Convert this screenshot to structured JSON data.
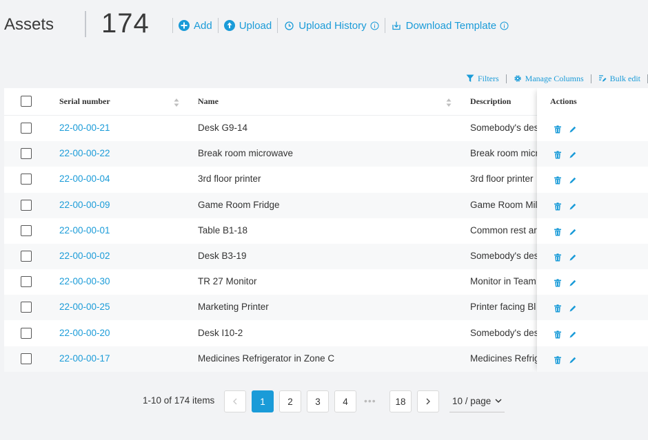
{
  "header": {
    "title": "Assets",
    "count": "174",
    "links": [
      {
        "label": "Add",
        "icon": "plus-circle-icon"
      },
      {
        "label": "Upload",
        "icon": "upload-circle-icon"
      },
      {
        "label": "Upload History",
        "icon": "history-icon",
        "info": true
      },
      {
        "label": "Download Template",
        "icon": "download-icon",
        "info": true
      }
    ]
  },
  "toolbar": {
    "filters": "Filters",
    "manage_columns": "Manage Columns",
    "bulk_edit": "Bulk edit"
  },
  "table": {
    "columns": {
      "serial": "Serial number",
      "name": "Name",
      "description": "Description",
      "actions": "Actions"
    },
    "rows": [
      {
        "serial": "22-00-00-21",
        "name": "Desk G9-14",
        "description": "Somebody's desk"
      },
      {
        "serial": "22-00-00-22",
        "name": "Break room microwave",
        "description": "Break room microwave"
      },
      {
        "serial": "22-00-00-04",
        "name": "3rd floor printer",
        "description": "3rd floor printer"
      },
      {
        "serial": "22-00-00-09",
        "name": "Game Room Fridge",
        "description": "Game Room Mill"
      },
      {
        "serial": "22-00-00-01",
        "name": "Table B1-18",
        "description": "Common rest area"
      },
      {
        "serial": "22-00-00-02",
        "name": "Desk B3-19",
        "description": "Somebody's desk"
      },
      {
        "serial": "22-00-00-30",
        "name": "TR 27 Monitor",
        "description": "Monitor in Team"
      },
      {
        "serial": "22-00-00-25",
        "name": "Marketing Printer",
        "description": "Printer facing Bl"
      },
      {
        "serial": "22-00-00-20",
        "name": "Desk I10-2",
        "description": "Somebody's desk"
      },
      {
        "serial": "22-00-00-17",
        "name": "Medicines Refrigerator in Zone C",
        "description": "Medicines Refrigerator"
      }
    ]
  },
  "pagination": {
    "total_text": "1-10 of 174 items",
    "prev": "<",
    "next": ">",
    "pages": [
      "1",
      "2",
      "3",
      "4"
    ],
    "ellipsis": "•••",
    "last_page": "18",
    "current": "1",
    "page_size": "10 / page"
  },
  "colors": {
    "accent": "#1a9bd8",
    "background": "#f2f3f5"
  }
}
